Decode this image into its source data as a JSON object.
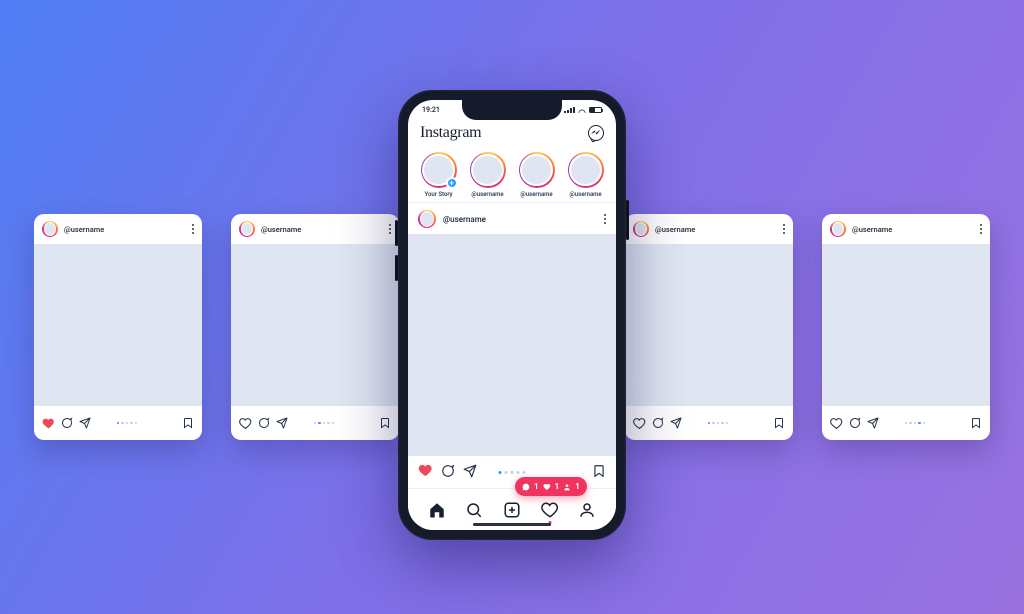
{
  "status_time": "19:21",
  "brand_name": "Instagram",
  "stories": [
    {
      "label": "Your Story",
      "has_add": true
    },
    {
      "label": "@username",
      "has_add": false
    },
    {
      "label": "@username",
      "has_add": false
    },
    {
      "label": "@username",
      "has_add": false
    }
  ],
  "feed_post": {
    "username": "@username",
    "carousel_dots": 5,
    "active_dot": 0
  },
  "side_cards": [
    {
      "username": "@username",
      "liked": true,
      "dots": 5,
      "active": 0
    },
    {
      "username": "@username",
      "liked": false,
      "dots": 5,
      "active": 1
    },
    {
      "username": "@username",
      "liked": false,
      "dots": 5,
      "active": 0
    },
    {
      "username": "@username",
      "liked": false,
      "dots": 5,
      "active": 3
    }
  ],
  "activity": {
    "comments": "1",
    "likes": "1",
    "follows": "1"
  },
  "colors": {
    "heart_filled": "#ed4956",
    "bubble": "#f0335f",
    "pager_active": "#3e8cff"
  }
}
